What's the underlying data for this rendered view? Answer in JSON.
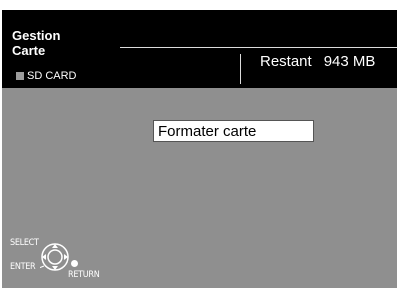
{
  "header": {
    "title_line1": "Gestion",
    "title_line2": "Carte",
    "card_type": "SD CARD",
    "remaining_label": "Restant",
    "remaining_value": "943 MB"
  },
  "menu": {
    "items": [
      {
        "label": "Formater carte",
        "selected": true
      }
    ]
  },
  "remote_hints": {
    "select_label": "SELECT",
    "enter_label": "ENTER",
    "return_label": "RETURN"
  },
  "colors": {
    "header_bg": "#000000",
    "screen_bg": "#8f8f8f",
    "highlight_bg": "#ffffff",
    "text_light": "#ffffff"
  }
}
